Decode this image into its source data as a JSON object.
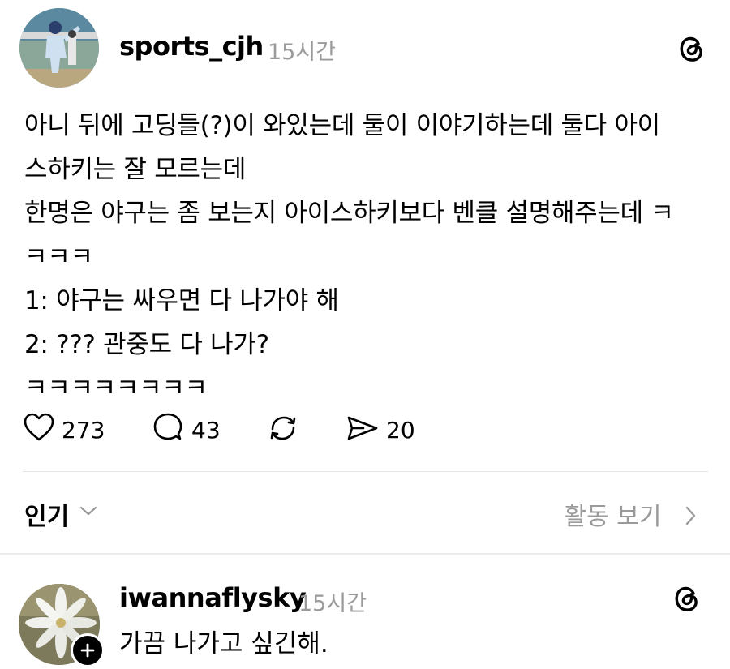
{
  "post": {
    "username": "sports_cjh",
    "time": "15시간",
    "lines": [
      "아니 뒤에 고딩들(?)이 와있는데 둘이 이야기하는데 둘다 아이",
      "스하키는 잘 모르는데",
      "한명은 야구는 좀 보는지 아이스하키보다 벤클 설명해주는데 ㅋ",
      "ㅋㅋㅋ",
      "1: 야구는 싸우면 다 나가야 해",
      "2: ??? 관중도 다 나가?",
      "ㅋㅋㅋㅋㅋㅋㅋㅋ"
    ],
    "actions": {
      "likes": "273",
      "comments": "43",
      "shares": "20"
    }
  },
  "sort": {
    "label": "인기",
    "activity": "활동 보기"
  },
  "reply": {
    "username": "iwannaflysky",
    "time": "15시간",
    "text": "가끔 나가고 싶긴해."
  },
  "icons": {
    "app": "threads-icon",
    "like": "heart-icon",
    "comment": "comment-bubble-icon",
    "repost": "repost-icon",
    "share": "send-icon"
  }
}
